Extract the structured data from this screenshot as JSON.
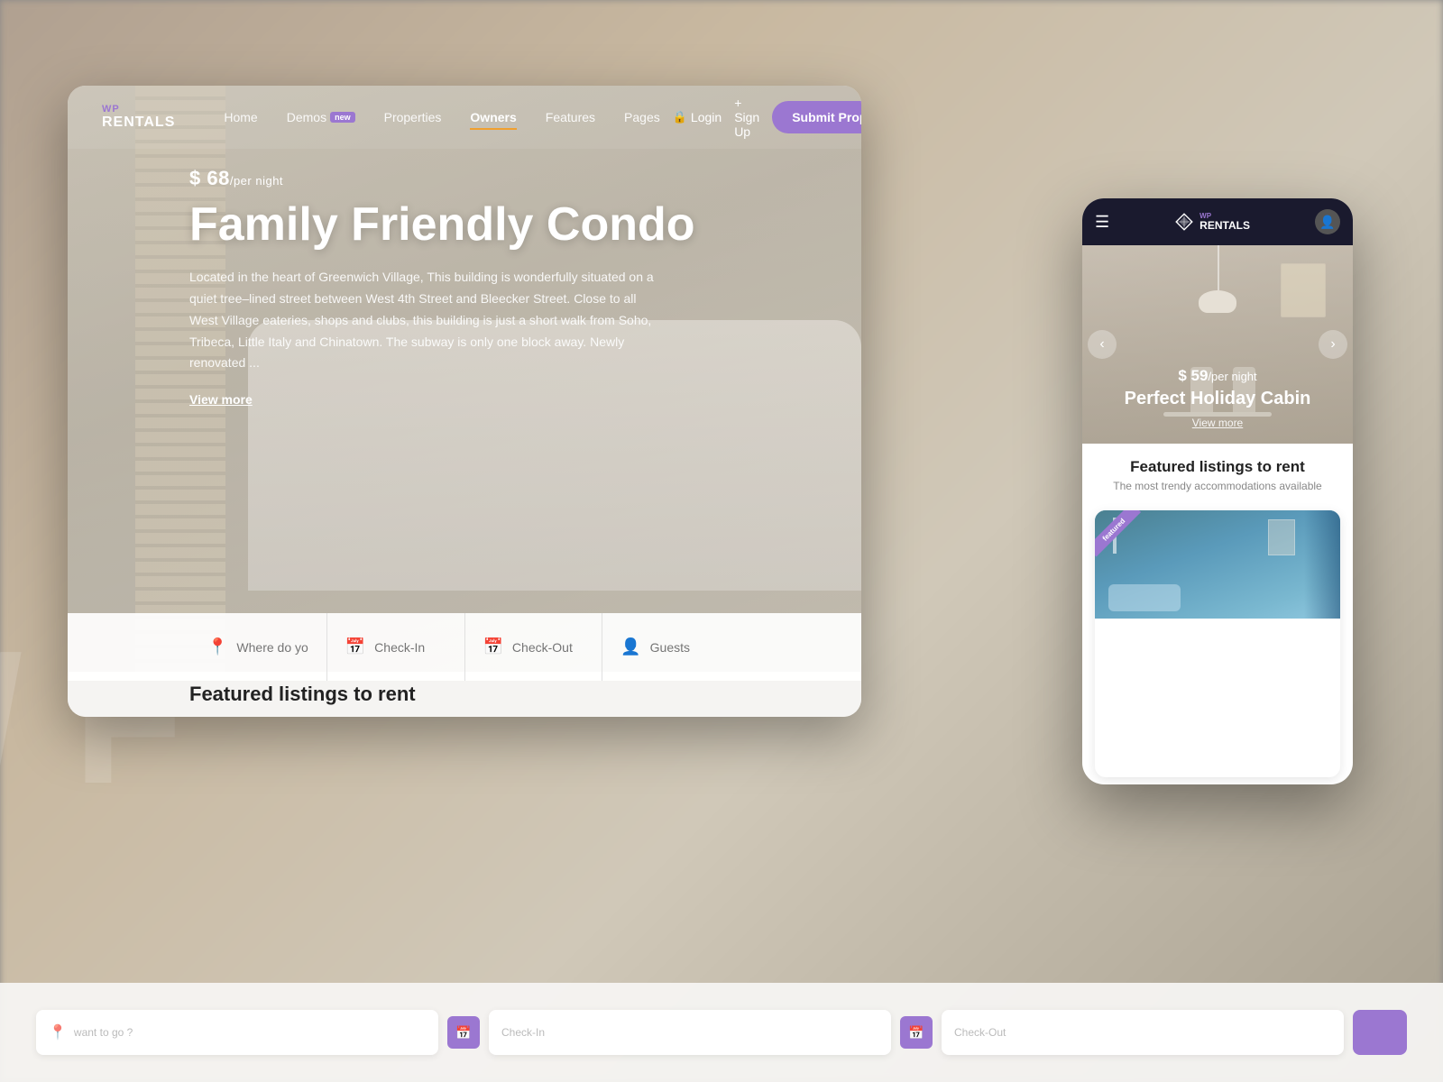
{
  "background": {
    "blur_text": "/ F"
  },
  "desktop_card": {
    "navbar": {
      "logo": {
        "wp": "WP",
        "rentals": "RENTALS"
      },
      "links": [
        {
          "id": "home",
          "label": "Home",
          "active": false,
          "badge": null
        },
        {
          "id": "demos",
          "label": "Demos",
          "active": false,
          "badge": "new"
        },
        {
          "id": "properties",
          "label": "Properties",
          "active": false,
          "badge": null
        },
        {
          "id": "owners",
          "label": "Owners",
          "active": true,
          "badge": null
        },
        {
          "id": "features",
          "label": "Features",
          "active": false,
          "badge": null
        },
        {
          "id": "pages",
          "label": "Pages",
          "active": false,
          "badge": null
        }
      ],
      "login_label": "Login",
      "signup_label": "+ Sign Up",
      "submit_label": "Submit Property"
    },
    "hero": {
      "price": "$ 68",
      "price_unit": "/per night",
      "title": "Family Friendly Condo",
      "description": "Located in the heart of Greenwich Village, This building is wonderfully situated on a quiet tree–lined street between West 4th Street and Bleecker Street. Close to all West Village eateries, shops and clubs, this building is just a short walk from Soho, Tribeca, Little Italy and Chinatown. The subway is only one block away. Newly renovated ...",
      "view_more": "View more"
    },
    "search_bar": {
      "location_placeholder": "Where do you want to go ?",
      "checkin_placeholder": "Check-In",
      "checkout_placeholder": "Check-Out",
      "guests_placeholder": "Guests"
    },
    "featured": {
      "title": "Featured listings to rent"
    }
  },
  "mobile_card": {
    "navbar": {
      "wp": "WP",
      "rentals": "RENTALS"
    },
    "hero": {
      "price": "$ 59",
      "price_unit": "/per night",
      "title": "Perfect Holiday Cabin",
      "view_more": "View more",
      "arrow_left": "‹",
      "arrow_right": "›"
    },
    "featured": {
      "title": "Featured listings to rent",
      "subtitle": "The most trendy accommodations available",
      "badge": "featured"
    }
  },
  "bottom_bar": {
    "location_placeholder": "want to go ?",
    "checkin_label": "Check-In",
    "checkout_label": "Check-Out"
  },
  "colors": {
    "purple": "#9b77d1",
    "dark_navy": "#1a1a2e",
    "orange_accent": "#f0a030",
    "light_bg": "#f5f4f2"
  }
}
